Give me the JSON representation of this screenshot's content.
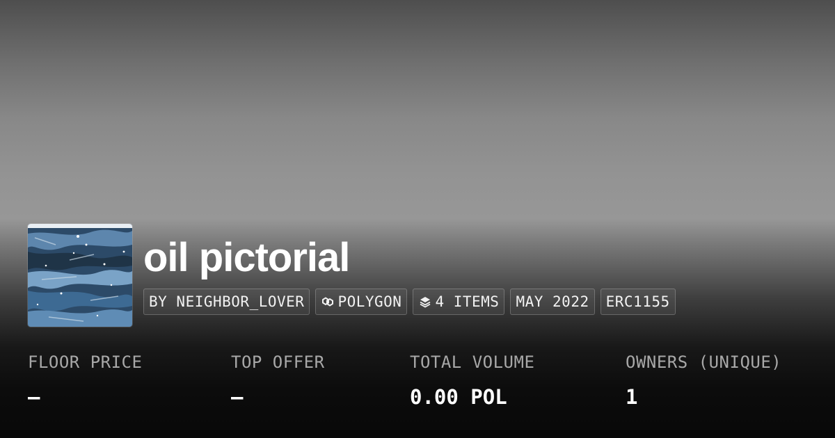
{
  "collection": {
    "title": "oil pictorial",
    "thumbnail_icon": "oil-painting-thumbnail"
  },
  "chips": {
    "creator": "BY NEIGHBOR_LOVER",
    "chain": "POLYGON",
    "chain_icon": "polygon-icon",
    "items": "4 ITEMS",
    "items_icon": "layers-icon",
    "date": "MAY 2022",
    "standard": "ERC1155"
  },
  "stats": {
    "floor_price": {
      "label": "FLOOR PRICE",
      "value": "–"
    },
    "top_offer": {
      "label": "TOP OFFER",
      "value": "–"
    },
    "total_volume": {
      "label": "TOTAL VOLUME",
      "value": "0.00 POL"
    },
    "owners": {
      "label": "OWNERS (UNIQUE)",
      "value": "1"
    }
  },
  "colors": {
    "text": "#ffffff",
    "label": "#a8a8a8",
    "background_bottom": "#080808"
  }
}
